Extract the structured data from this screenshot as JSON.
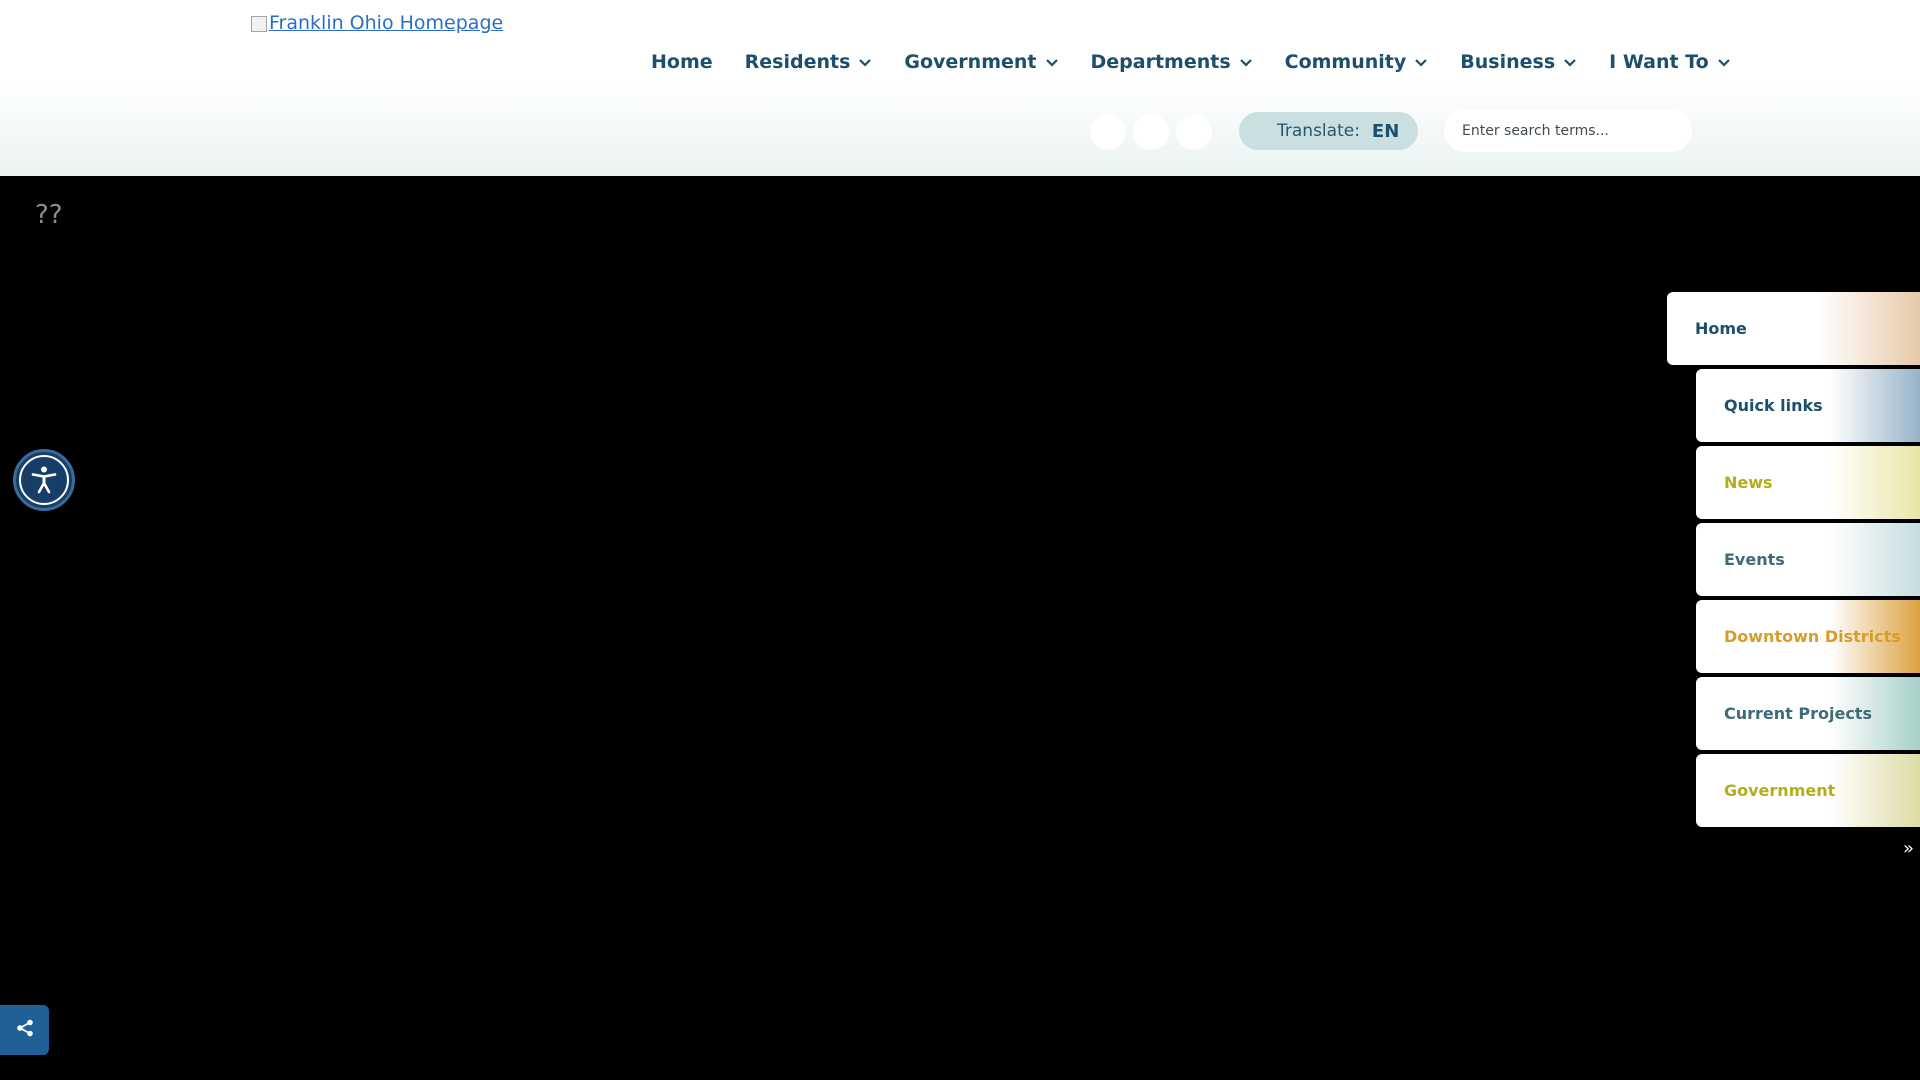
{
  "header": {
    "logo_alt": "Franklin Ohio Homepage",
    "nav": [
      {
        "label": "Home",
        "has_dropdown": false
      },
      {
        "label": "Residents",
        "has_dropdown": true
      },
      {
        "label": "Government",
        "has_dropdown": true
      },
      {
        "label": "Departments",
        "has_dropdown": true
      },
      {
        "label": "Community",
        "has_dropdown": true
      },
      {
        "label": "Business",
        "has_dropdown": true
      },
      {
        "label": "I Want To",
        "has_dropdown": true
      }
    ],
    "translate_label": "Translate:",
    "translate_lang": "EN",
    "search_placeholder": "Enter search terms..."
  },
  "placeholder_glyph": "??",
  "side_menu": {
    "items": [
      {
        "label": "Home",
        "color": "#1d4e6b",
        "accent": "#e6c9a8"
      },
      {
        "label": "Quick links",
        "color": "#1d4e6b",
        "accent": "#97b3c8"
      },
      {
        "label": "News",
        "color": "#b4ae1b",
        "accent": "#e8e6a6"
      },
      {
        "label": "Events",
        "color": "#3f6b78",
        "accent": "#c6dde0"
      },
      {
        "label": "Downtown Districts",
        "color": "#d69d2c",
        "accent": "#dca140"
      },
      {
        "label": "Current Projects",
        "color": "#3f6b78",
        "accent": "#a7d0c9"
      },
      {
        "label": "Government",
        "color": "#b4ae1b",
        "accent": "#dedba4"
      }
    ],
    "expand_glyph": "»"
  },
  "colors": {
    "nav_text": "#1d4e6b",
    "accessibility_button": "#173e68",
    "share_button": "#1f6096"
  },
  "icons": {
    "accessibility": "accessibility-icon",
    "share": "share-icon",
    "chevron": "chevron-down-icon"
  }
}
